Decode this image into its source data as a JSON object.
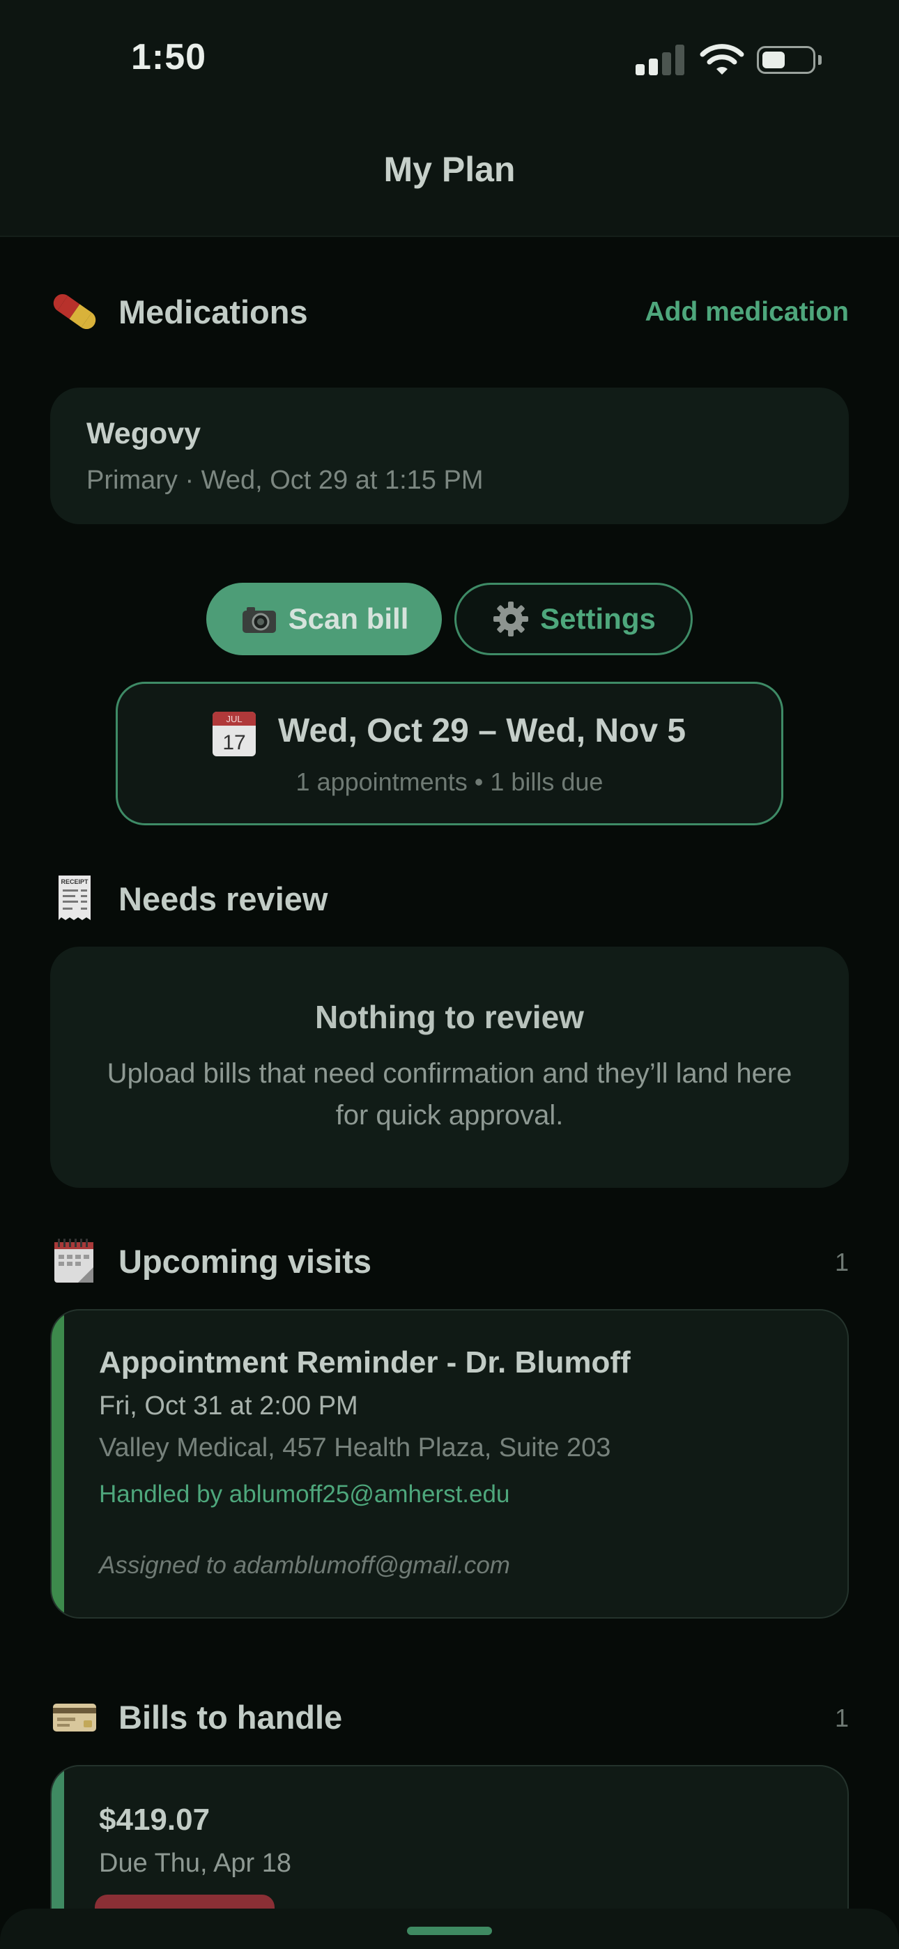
{
  "status_bar": {
    "time": "1:50",
    "icons": [
      "cellular-signal-icon",
      "wifi-icon",
      "battery-icon"
    ],
    "signal_bars_filled": 2,
    "signal_bars_total": 4
  },
  "header": {
    "title": "My Plan"
  },
  "medications": {
    "icon": "pill-icon",
    "title": "Medications",
    "add_label": "Add medication",
    "items": [
      {
        "name": "Wegovy",
        "detail": "Primary · Wed, Oct 29 at 1:15 PM"
      }
    ]
  },
  "actions": {
    "scan_icon": "camera-icon",
    "scan_label": "Scan bill",
    "settings_icon": "gear-icon",
    "settings_label": "Settings"
  },
  "range": {
    "icon": "calendar-icon",
    "calendar_month": "JUL",
    "calendar_day": "17",
    "title": "Wed, Oct 29 – Wed, Nov 5",
    "summary": "1 appointments • 1 bills due"
  },
  "needs_review": {
    "icon": "receipt-icon",
    "receipt_heading": "RECEIPT",
    "title": "Needs review",
    "empty_title": "Nothing to review",
    "empty_body": "Upload bills that need confirmation and they’ll land here for quick approval."
  },
  "upcoming_visits": {
    "icon": "spiral-calendar-icon",
    "title": "Upcoming visits",
    "count": "1",
    "items": [
      {
        "title": "Appointment Reminder - Dr. Blumoff",
        "time": "Fri, Oct 31 at 2:00 PM",
        "location": "Valley Medical, 457 Health Plaza, Suite 203",
        "handled_by": "Handled by ablumoff25@amherst.edu",
        "assigned_to": "Assigned to adamblumoff@gmail.com"
      }
    ]
  },
  "bills": {
    "icon": "credit-card-icon",
    "title": "Bills to handle",
    "count": "1",
    "items": [
      {
        "amount": "$419.07",
        "due": "Due Thu, Apr 18"
      }
    ]
  },
  "colors": {
    "accent": "#4ea77c",
    "button_fill": "#4d9d77",
    "visit_accent": "#3d8a4c",
    "bill_badge": "#8a2f35",
    "background": "#060b08"
  }
}
